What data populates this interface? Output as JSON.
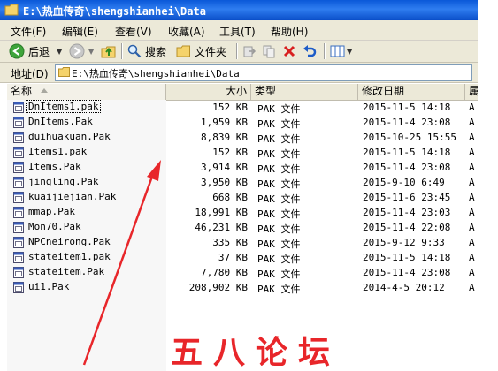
{
  "window": {
    "title": "E:\\热血传奇\\shengshianhei\\Data"
  },
  "menu": [
    "文件(F)",
    "编辑(E)",
    "查看(V)",
    "收藏(A)",
    "工具(T)",
    "帮助(H)"
  ],
  "toolbar": {
    "back_label": "后退",
    "search_label": "搜索",
    "folders_label": "文件夹"
  },
  "address": {
    "label": "地址(D)",
    "value": "E:\\热血传奇\\shengshianhei\\Data"
  },
  "columns": {
    "name": "名称",
    "size": "大小",
    "type": "类型",
    "modified": "修改日期",
    "attr": "属"
  },
  "files": [
    {
      "name": "DnItems1.pak",
      "size": "152 KB",
      "type": "PAK 文件",
      "modified": "2015-11-5 14:18",
      "attr": "A"
    },
    {
      "name": "DnItems.Pak",
      "size": "1,959 KB",
      "type": "PAK 文件",
      "modified": "2015-11-4 23:08",
      "attr": "A"
    },
    {
      "name": "duihuakuan.Pak",
      "size": "8,839 KB",
      "type": "PAK 文件",
      "modified": "2015-10-25 15:55",
      "attr": "A"
    },
    {
      "name": "Items1.pak",
      "size": "152 KB",
      "type": "PAK 文件",
      "modified": "2015-11-5 14:18",
      "attr": "A"
    },
    {
      "name": "Items.Pak",
      "size": "3,914 KB",
      "type": "PAK 文件",
      "modified": "2015-11-4 23:08",
      "attr": "A"
    },
    {
      "name": "jingling.Pak",
      "size": "3,950 KB",
      "type": "PAK 文件",
      "modified": "2015-9-10 6:49",
      "attr": "A"
    },
    {
      "name": "kuaijiejian.Pak",
      "size": "668 KB",
      "type": "PAK 文件",
      "modified": "2015-11-6 23:45",
      "attr": "A"
    },
    {
      "name": "mmap.Pak",
      "size": "18,991 KB",
      "type": "PAK 文件",
      "modified": "2015-11-4 23:03",
      "attr": "A"
    },
    {
      "name": "Mon70.Pak",
      "size": "46,231 KB",
      "type": "PAK 文件",
      "modified": "2015-11-4 22:08",
      "attr": "A"
    },
    {
      "name": "NPCneirong.Pak",
      "size": "335 KB",
      "type": "PAK 文件",
      "modified": "2015-9-12 9:33",
      "attr": "A"
    },
    {
      "name": "stateitem1.pak",
      "size": "37 KB",
      "type": "PAK 文件",
      "modified": "2015-11-5 14:18",
      "attr": "A"
    },
    {
      "name": "stateitem.Pak",
      "size": "7,780 KB",
      "type": "PAK 文件",
      "modified": "2015-11-4 23:08",
      "attr": "A"
    },
    {
      "name": "ui1.Pak",
      "size": "208,902 KB",
      "type": "PAK 文件",
      "modified": "2014-4-5 20:12",
      "attr": "A"
    }
  ],
  "focused_row": 0,
  "watermark": "五八论坛",
  "colors": {
    "titlebar": "#0a58d8",
    "chrome": "#ece9d8",
    "annotation": "#e8262a"
  }
}
